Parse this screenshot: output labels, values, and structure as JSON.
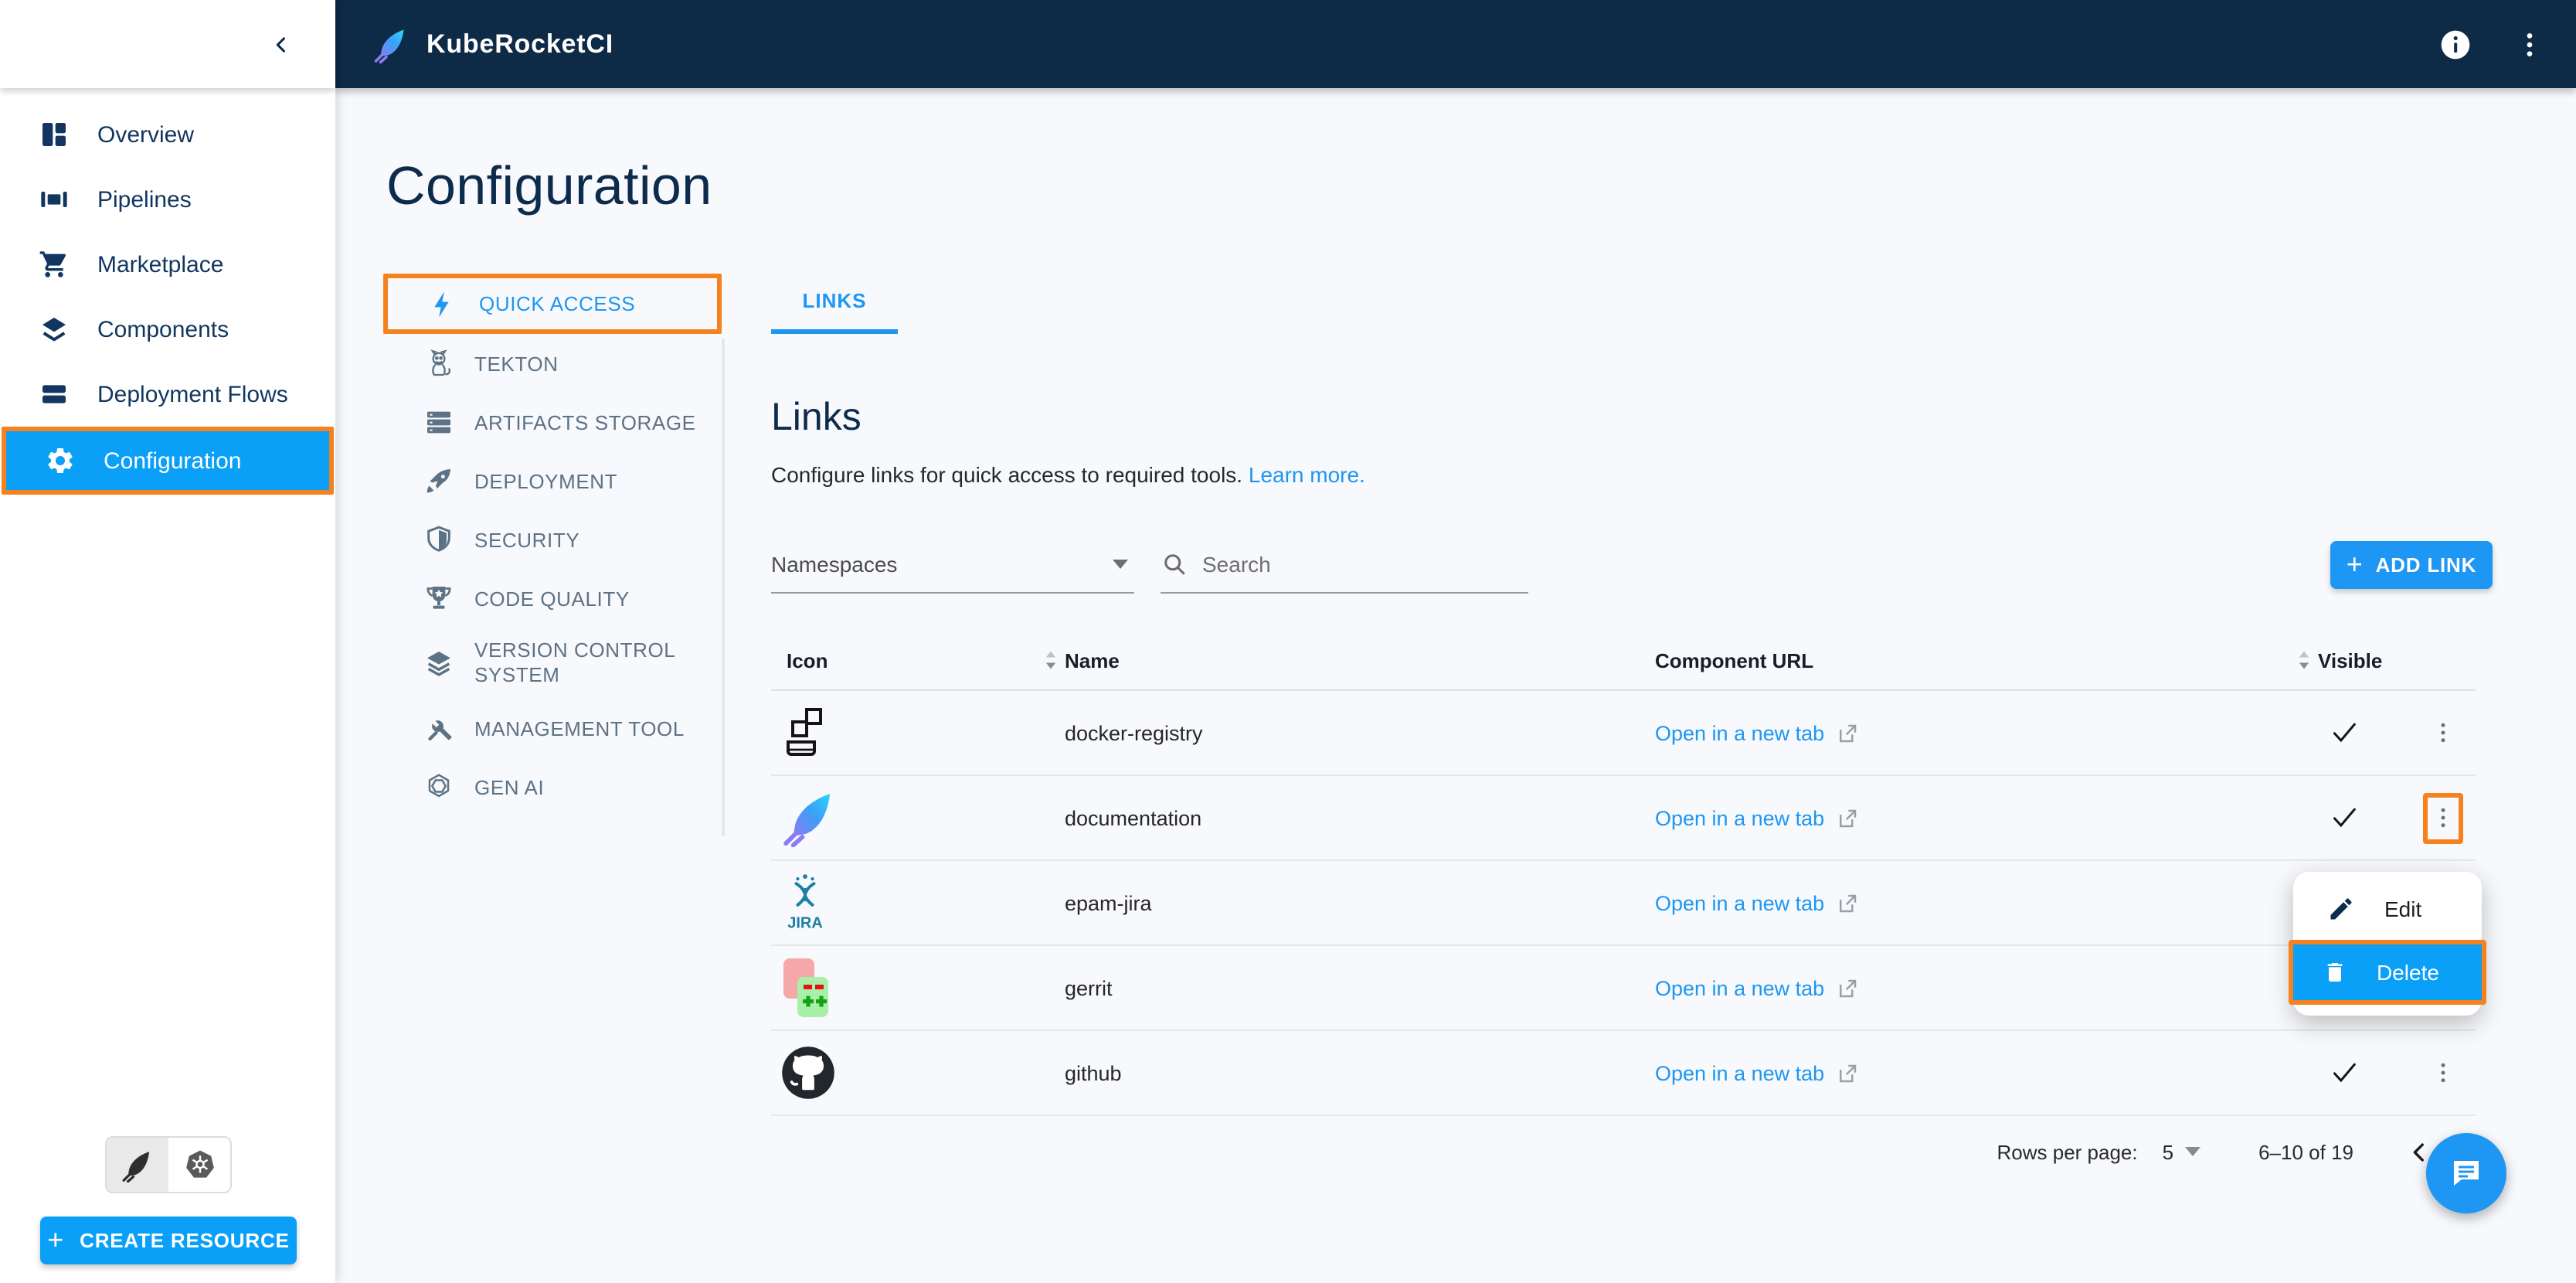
{
  "topbar": {
    "brand": "KubeRocketCI",
    "icons": [
      "info-icon",
      "kebab-menu-icon"
    ]
  },
  "sidebar": {
    "items": [
      {
        "label": "Overview",
        "icon": "overview-icon",
        "active": false
      },
      {
        "label": "Pipelines",
        "icon": "pipelines-icon",
        "active": false
      },
      {
        "label": "Marketplace",
        "icon": "cart-icon",
        "active": false
      },
      {
        "label": "Components",
        "icon": "components-icon",
        "active": false
      },
      {
        "label": "Deployment Flows",
        "icon": "deployment-flows-icon",
        "active": false
      },
      {
        "label": "Configuration",
        "icon": "gear-icon",
        "active": true,
        "highlighted": true
      }
    ],
    "view_toggle": [
      "kuberocketci-feather-icon",
      "kubernetes-wheel-icon"
    ],
    "view_toggle_selected": 0,
    "create_button": "CREATE RESOURCE"
  },
  "page": {
    "title": "Configuration"
  },
  "config_menu": {
    "items": [
      {
        "label": "QUICK ACCESS",
        "icon": "lightning-icon",
        "active": true,
        "highlighted": true
      },
      {
        "label": "TEKTON",
        "icon": "tekton-cat-icon",
        "active": false
      },
      {
        "label": "ARTIFACTS STORAGE",
        "icon": "storage-icon",
        "active": false
      },
      {
        "label": "DEPLOYMENT",
        "icon": "rocket-icon",
        "active": false
      },
      {
        "label": "SECURITY",
        "icon": "shield-icon",
        "active": false
      },
      {
        "label": "CODE QUALITY",
        "icon": "trophy-icon",
        "active": false
      },
      {
        "label": "VERSION CONTROL SYSTEM",
        "icon": "layers-icon",
        "active": false
      },
      {
        "label": "MANAGEMENT TOOL",
        "icon": "tools-icon",
        "active": false
      },
      {
        "label": "GEN AI",
        "icon": "openai-icon",
        "active": false
      }
    ]
  },
  "tabs": [
    {
      "label": "LINKS",
      "active": true
    }
  ],
  "links_section": {
    "heading": "Links",
    "description": "Configure links for quick access to required tools.",
    "learn_more": "Learn more.",
    "namespaces_label": "Namespaces",
    "search_placeholder": "Search",
    "add_button": "ADD LINK"
  },
  "table": {
    "columns": [
      "Icon",
      "Name",
      "Component URL",
      "Visible"
    ],
    "sortable_columns": [
      "Name",
      "Visible"
    ],
    "link_label": "Open in a new tab",
    "rows": [
      {
        "icon": "docker-registry-icon",
        "name": "docker-registry",
        "link_label": "Open in a new tab",
        "visible": true
      },
      {
        "icon": "documentation-feather-icon",
        "name": "documentation",
        "link_label": "Open in a new tab",
        "visible": true,
        "menu_open": true
      },
      {
        "icon": "jira-icon",
        "name": "epam-jira",
        "link_label": "Open in a new tab",
        "visible": true
      },
      {
        "icon": "gerrit-icon",
        "name": "gerrit",
        "link_label": "Open in a new tab",
        "visible": true
      },
      {
        "icon": "github-icon",
        "name": "github",
        "link_label": "Open in a new tab",
        "visible": true
      }
    ]
  },
  "context_menu": {
    "items": [
      {
        "label": "Edit",
        "icon": "pencil-icon",
        "highlighted": false
      },
      {
        "label": "Delete",
        "icon": "trash-icon",
        "highlighted": true
      }
    ]
  },
  "pagination": {
    "rows_per_page_label": "Rows per page:",
    "rows_per_page_value": "5",
    "range": "6–10 of 19"
  },
  "colors": {
    "topbar_navy": "#0d2a47",
    "sidebar_text_navy": "#12365F",
    "active_blue": "#0AA0F8",
    "link_blue": "#1E96F3",
    "highlight_orange": "#F5821F",
    "background": "#f7f9fc"
  }
}
